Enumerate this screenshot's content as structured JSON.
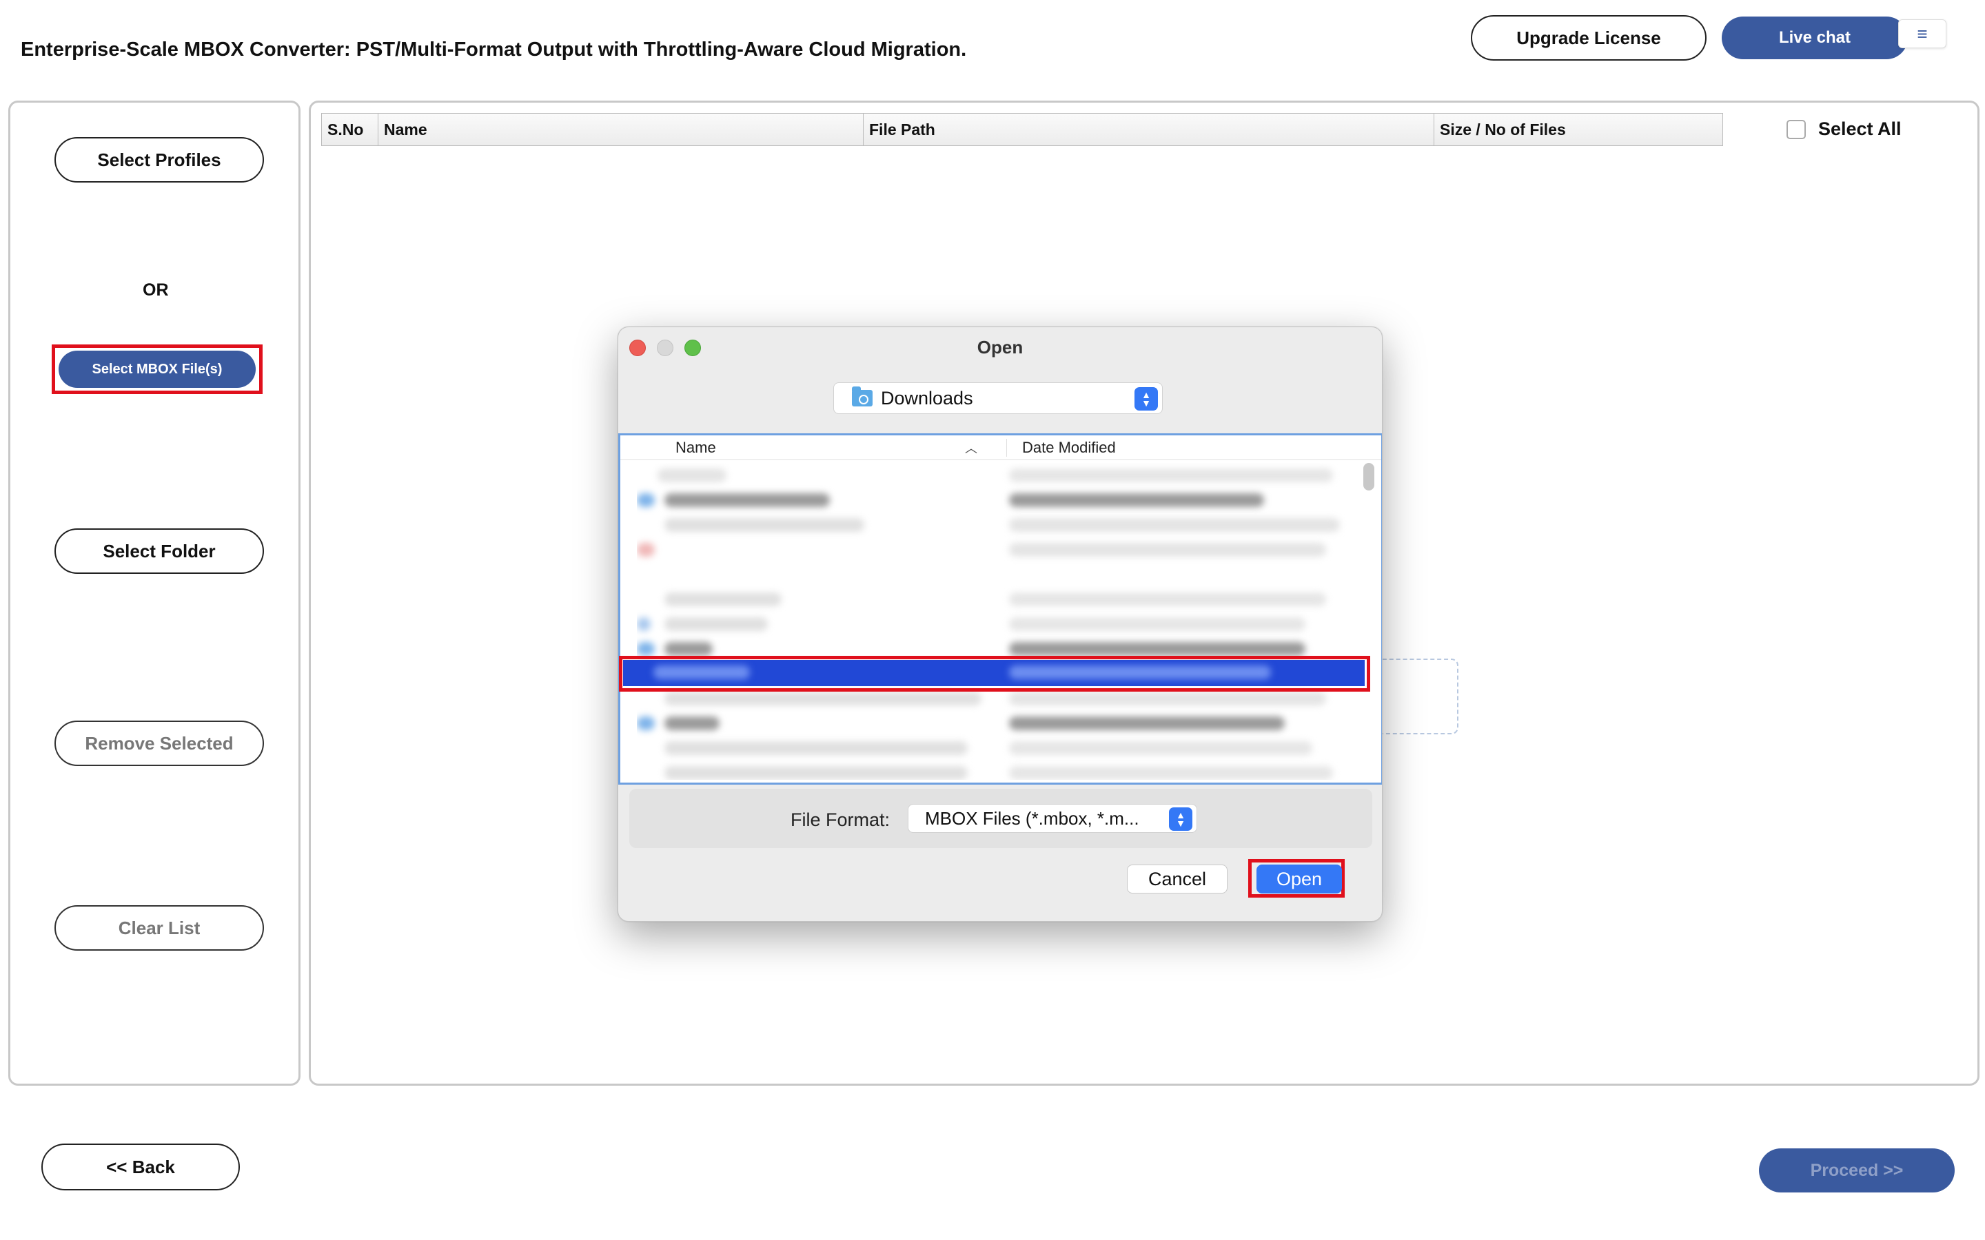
{
  "header": {
    "title": "Enterprise-Scale MBOX Converter: PST/Multi-Format Output with Throttling-Aware Cloud Migration.",
    "upgrade_label": "Upgrade License",
    "livechat_label": "Live chat",
    "menu_glyph": "≡"
  },
  "sidebar": {
    "select_profiles": "Select Profiles",
    "or_label": "OR",
    "select_mbox": "Select MBOX File(s)",
    "select_folder": "Select Folder",
    "remove_selected": "Remove Selected",
    "clear_list": "Clear List"
  },
  "table": {
    "columns": [
      "S.No",
      "Name",
      "File Path",
      "Size / No of Files"
    ],
    "select_all": "Select All"
  },
  "footer": {
    "back_label": "<< Back",
    "proceed_label": "Proceed >>"
  },
  "dialog": {
    "title": "Open",
    "location": "Downloads",
    "col_name": "Name",
    "col_date": "Date Modified",
    "file_format_label": "File Format:",
    "file_format_value": "MBOX Files (*.mbox, *.m...",
    "cancel_label": "Cancel",
    "open_label": "Open"
  },
  "colors": {
    "accent": "#3a5a9f",
    "highlight": "#e0101c",
    "mac_blue": "#3478f6",
    "selection": "#2148d6"
  }
}
